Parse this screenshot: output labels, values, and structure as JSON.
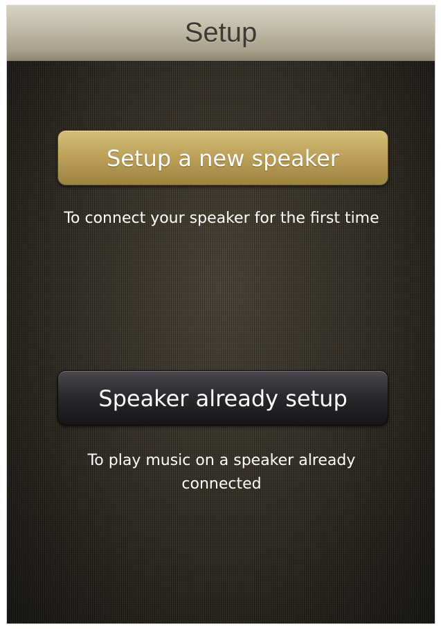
{
  "header": {
    "title": "Setup"
  },
  "options": [
    {
      "button_label": "Setup a new speaker",
      "description": "To connect your speaker for the first time"
    },
    {
      "button_label": "Speaker already setup",
      "description": "To play music on a speaker already connected"
    }
  ],
  "colors": {
    "primary_button": "#bea25a",
    "secondary_button": "#2b2b2e",
    "background": "#2e2a22",
    "header": "#c2bdaa"
  }
}
